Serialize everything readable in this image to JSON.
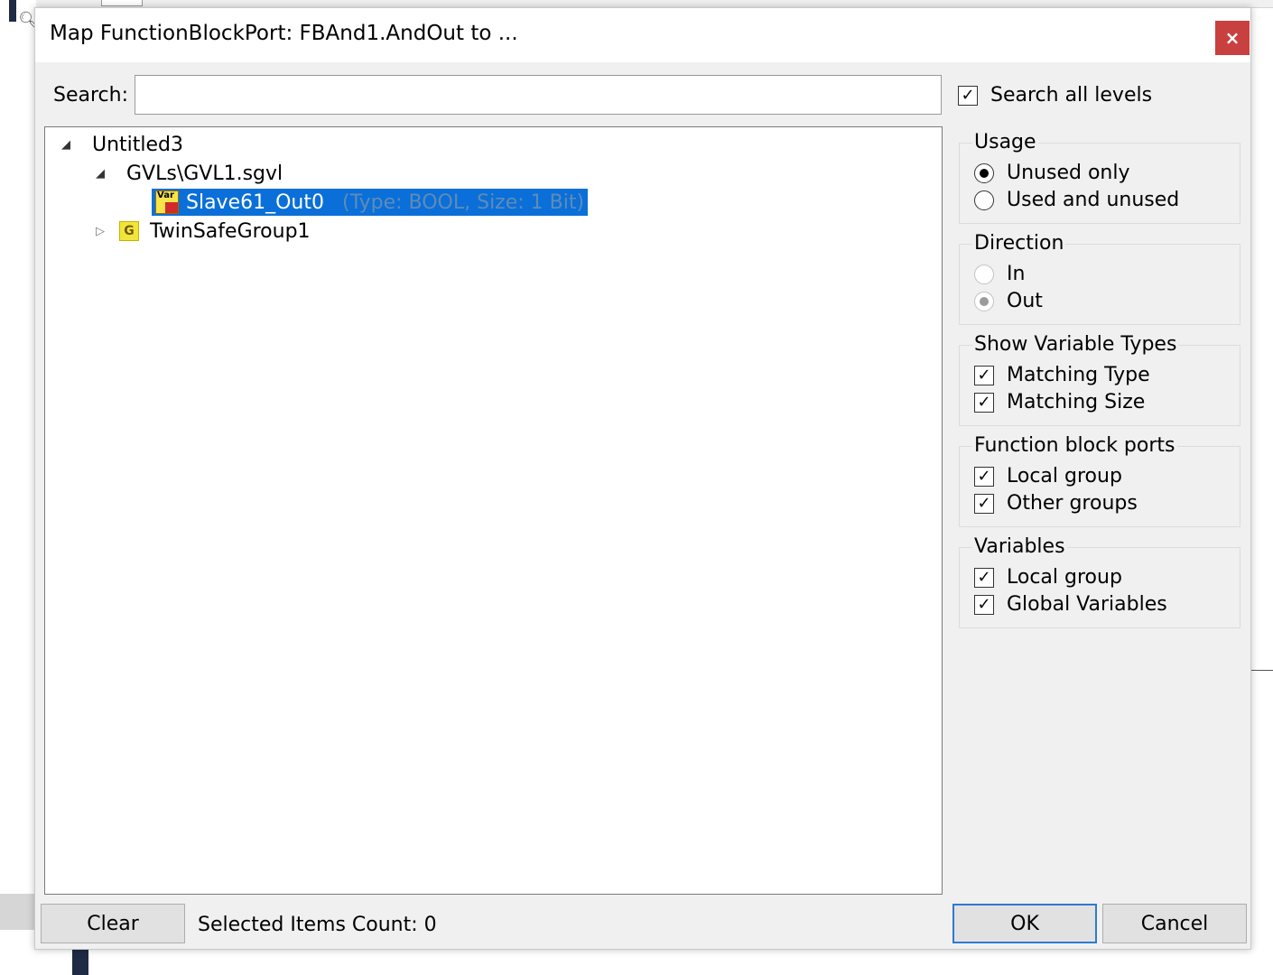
{
  "dialog": {
    "title": "Map FunctionBlockPort: FBAnd1.AndOut to ...",
    "close_symbol": "×"
  },
  "search": {
    "label": "Search:",
    "value": "",
    "search_all_levels": {
      "label": "Search all levels",
      "checked": true
    }
  },
  "tree": {
    "root": {
      "label": "Untitled3",
      "expanded": true
    },
    "gvl": {
      "label": "GVLs\\GVL1.sgvl",
      "expanded": true
    },
    "variable": {
      "label": "Slave61_Out0",
      "detail": "(Type: BOOL, Size: 1 Bit)",
      "icon_tag": "Var",
      "selected": true
    },
    "group": {
      "label": "TwinSafeGroup1",
      "icon_letter": "G",
      "expanded": false
    }
  },
  "usage": {
    "title": "Usage",
    "options": [
      {
        "label": "Unused only",
        "selected": true
      },
      {
        "label": "Used and unused",
        "selected": false
      }
    ]
  },
  "direction": {
    "title": "Direction",
    "options": [
      {
        "label": "In",
        "selected": false,
        "enabled": false
      },
      {
        "label": "Out",
        "selected": true,
        "enabled": false
      }
    ]
  },
  "show_variable_types": {
    "title": "Show Variable Types",
    "options": [
      {
        "label": "Matching Type",
        "checked": true
      },
      {
        "label": "Matching Size",
        "checked": true
      }
    ]
  },
  "function_block_ports": {
    "title": "Function block ports",
    "options": [
      {
        "label": "Local group",
        "checked": true
      },
      {
        "label": "Other groups",
        "checked": true
      }
    ]
  },
  "variables": {
    "title": "Variables",
    "options": [
      {
        "label": "Local group",
        "checked": true
      },
      {
        "label": "Global Variables",
        "checked": true
      }
    ]
  },
  "footer": {
    "clear_label": "Clear",
    "selected_count_text": "Selected Items Count: 0",
    "ok_label": "OK",
    "cancel_label": "Cancel"
  },
  "colors": {
    "selection": "#0a6fd8",
    "close_button": "#c8403f",
    "default_button_border": "#2e7ad1"
  }
}
